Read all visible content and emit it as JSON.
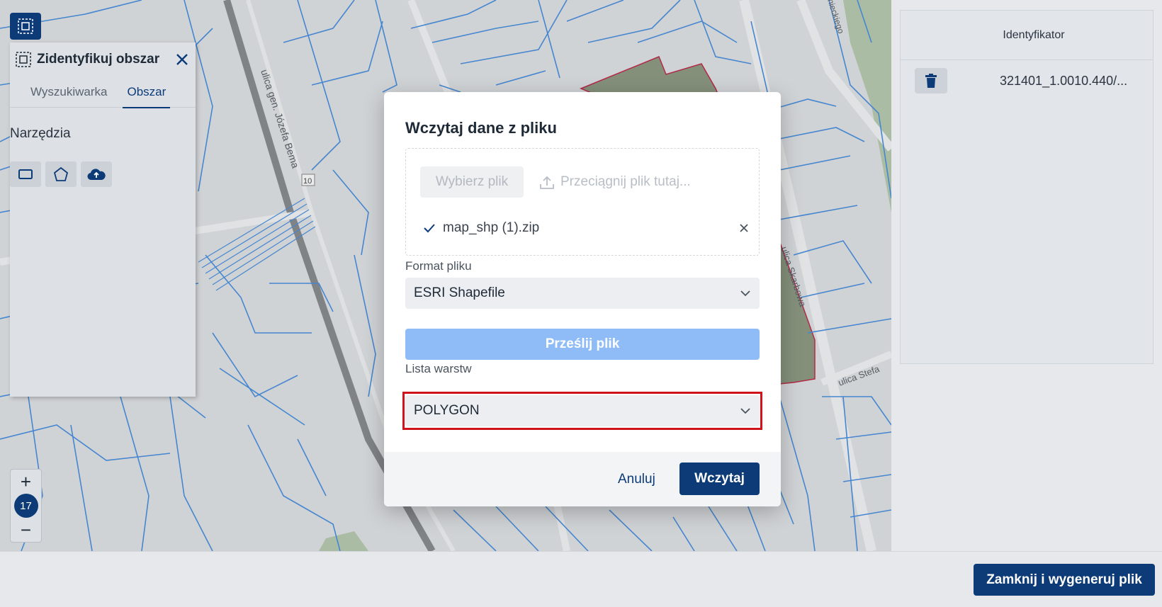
{
  "map": {
    "street_labels": [
      "ulica gen. Józefa Bema",
      "10",
      "ulica Skarbowa",
      "ulica Stefa",
      "nieckiego"
    ],
    "colors": {
      "parcel_lines": "#4a90e2",
      "highlight_area": "#8f9b83",
      "roads": "#c7cacd"
    }
  },
  "left_panel": {
    "title": "Zidentyfikuj obszar",
    "tabs": [
      {
        "label": "Wyszukiwarka",
        "active": false
      },
      {
        "label": "Obszar",
        "active": true
      }
    ],
    "tools_label": "Narzędzia",
    "tools": [
      "rectangle-icon",
      "pentagon-icon",
      "cloud-upload-icon"
    ]
  },
  "zoom": {
    "plus": "+",
    "level": "17",
    "minus": "−"
  },
  "right_panel": {
    "column_header": "Identyfikator",
    "rows": [
      {
        "id": "321401_1.0010.440/..."
      }
    ]
  },
  "footer": {
    "generate_label": "Zamknij i wygeneruj plik"
  },
  "modal": {
    "title": "Wczytaj dane z pliku",
    "choose_label": "Wybierz plik",
    "drop_hint": "Przeciągnij plik tutaj...",
    "file_name": "map_shp (1).zip",
    "format_label": "Format pliku",
    "format_value": "ESRI Shapefile",
    "upload_label": "Prześlij plik",
    "layers_label": "Lista warstw",
    "layers_value": "POLYGON",
    "cancel_label": "Anuluj",
    "load_label": "Wczytaj"
  },
  "colors": {
    "primary": "#0c3b78",
    "upload_disabled": "#8fbcf6",
    "highlight_border": "#d0121c"
  }
}
